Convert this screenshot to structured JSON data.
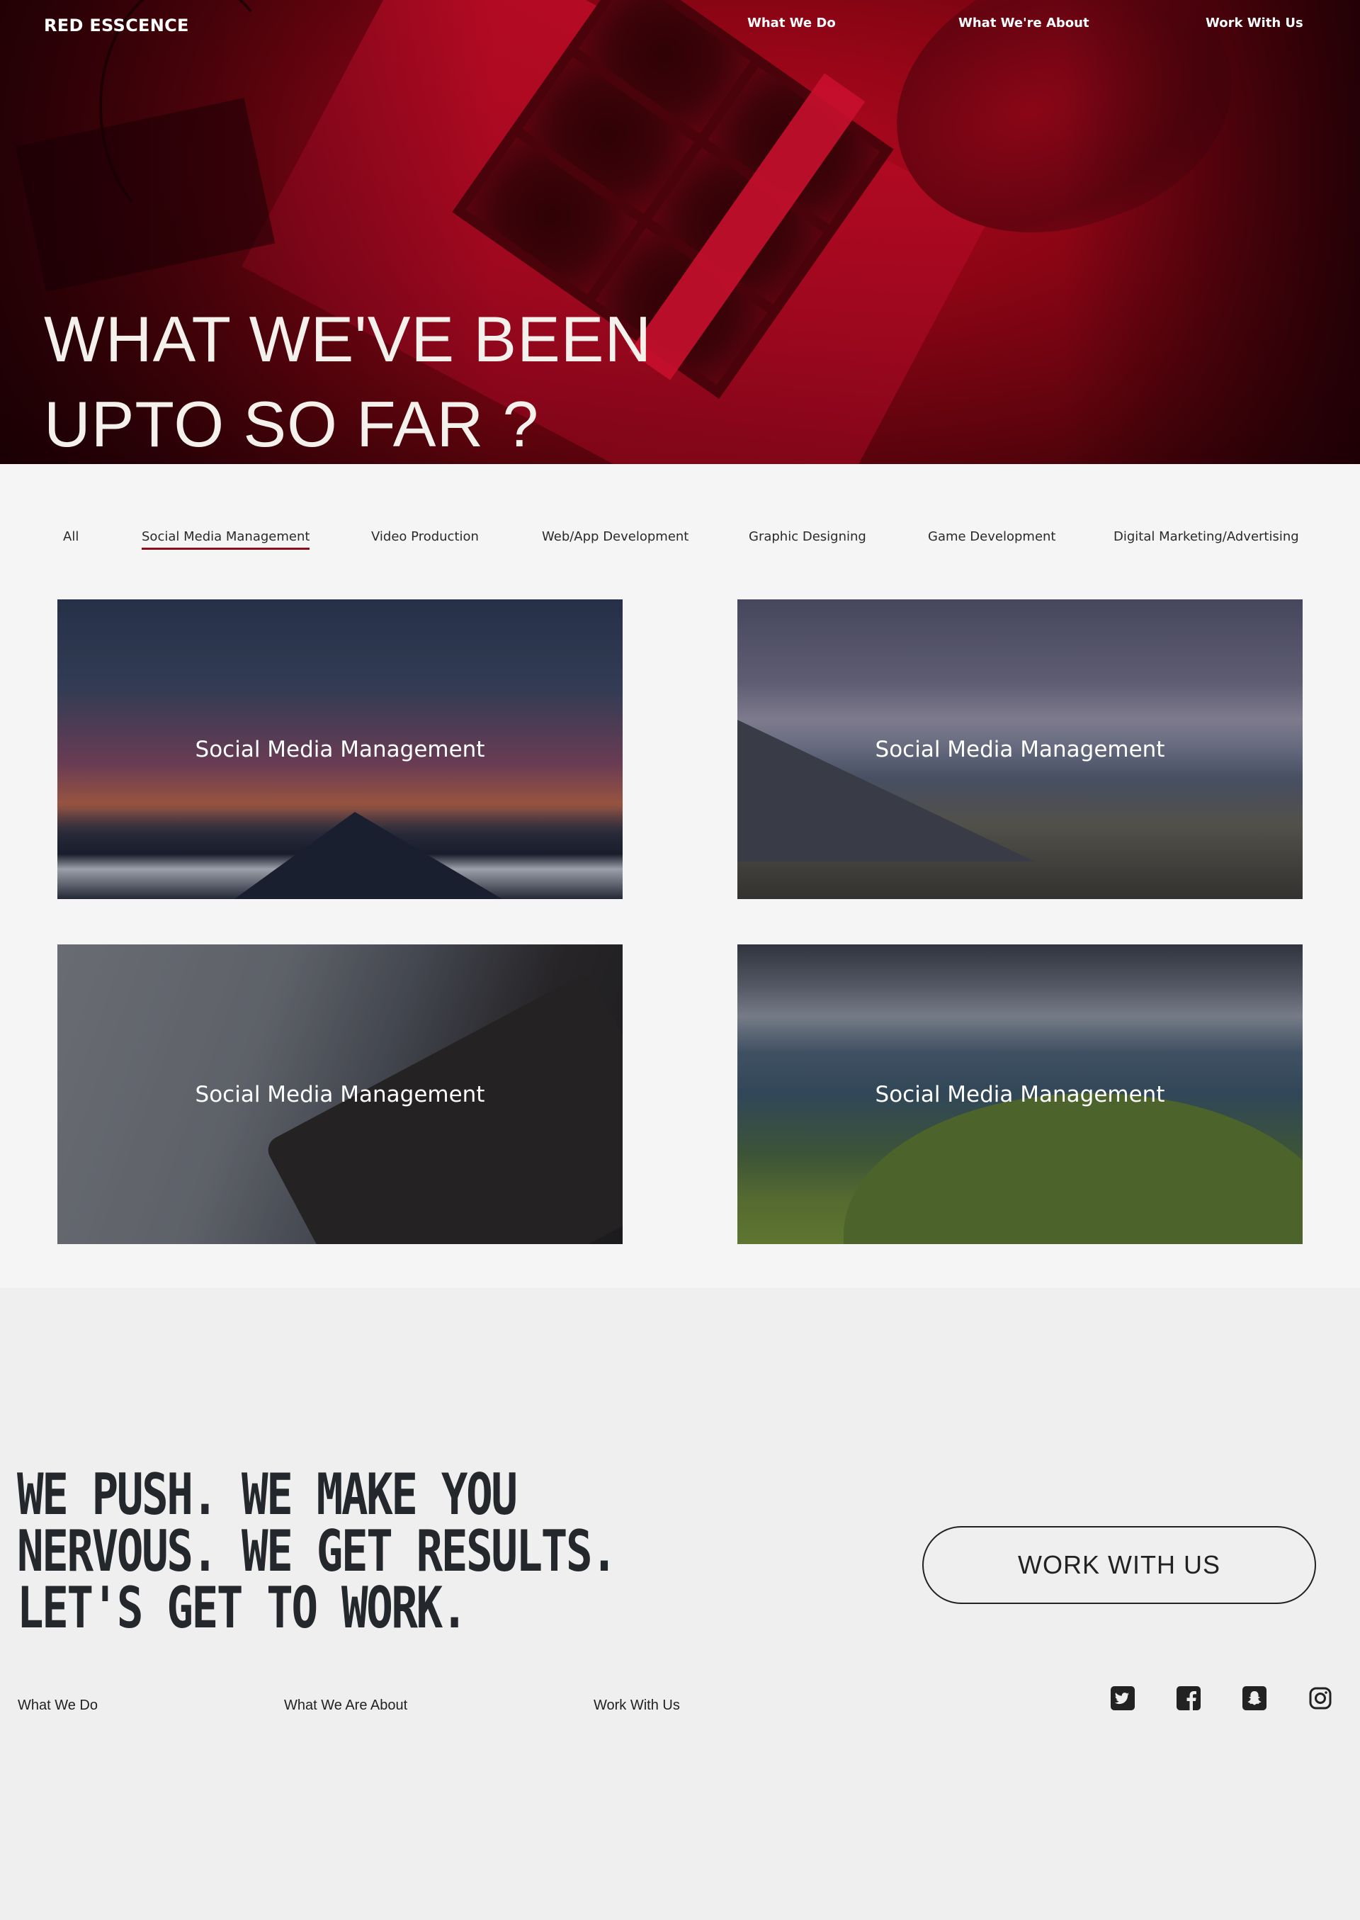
{
  "header": {
    "brand": "RED ESSCENCE",
    "nav": [
      "What We Do",
      "What We're About",
      "Work With Us"
    ]
  },
  "hero": {
    "title_line1": "WHAT WE'VE BEEN",
    "title_line2": "UPTO SO FAR ?"
  },
  "filters": {
    "items": [
      "All",
      "Social Media Management",
      "Video Production",
      "Web/App Development",
      "Graphic Designing",
      "Game Development",
      "Digital Marketing/Advertising"
    ],
    "active": "Social Media Management"
  },
  "portfolio": {
    "tiles": [
      {
        "label": "Social Media Management"
      },
      {
        "label": "Social Media Management"
      },
      {
        "label": "Social Media Management"
      },
      {
        "label": "Social Media Management"
      }
    ]
  },
  "footer": {
    "cta_lines": [
      "WE PUSH. WE MAKE YOU",
      "NERVOUS. WE GET RESULTS.",
      "LET'S GET TO WORK."
    ],
    "button_label": "WORK WITH US",
    "links": [
      "What We Do",
      "What We Are About",
      "Work With Us"
    ],
    "social_icons": [
      "twitter-icon",
      "facebook-icon",
      "snapchat-icon",
      "instagram-icon"
    ]
  },
  "colors": {
    "brand_red": "#a3081e",
    "active_underline": "#8a0d1a",
    "text_dark": "#24272c"
  }
}
